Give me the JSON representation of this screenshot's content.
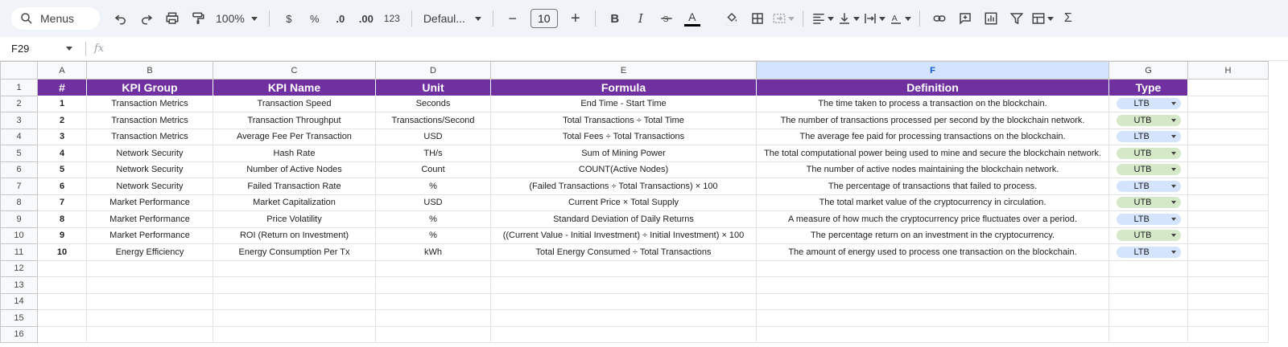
{
  "toolbar": {
    "search_label": "Menus",
    "zoom": "100%",
    "currency_symbol": "$",
    "percent_symbol": "%",
    "decrease_decimal": ".0",
    "increase_decimal": ".00",
    "number_format": "123",
    "font": "Defaul...",
    "font_size": "10",
    "minus": "−",
    "plus": "+",
    "bold": "B",
    "italic": "I",
    "text_color": "A",
    "function_sigma": "Σ"
  },
  "formula_bar": {
    "cell_ref": "F29",
    "fx_label": "fx",
    "content": ""
  },
  "columns": [
    "A",
    "B",
    "C",
    "D",
    "E",
    "F",
    "G",
    "H"
  ],
  "selected_column": "F",
  "row_numbers": [
    "1",
    "2",
    "3",
    "4",
    "5",
    "6",
    "7",
    "8",
    "9",
    "10",
    "11",
    "12",
    "13",
    "14",
    "15",
    "16"
  ],
  "header_row": [
    "#",
    "KPI Group",
    "KPI Name",
    "Unit",
    "Formula",
    "Definition",
    "Type"
  ],
  "rows": [
    {
      "num": "1",
      "group": "Transaction Metrics",
      "name": "Transaction Speed",
      "unit": "Seconds",
      "formula": "End Time - Start Time",
      "definition": "The time taken to process a transaction on the blockchain.",
      "type": "LTB"
    },
    {
      "num": "2",
      "group": "Transaction Metrics",
      "name": "Transaction Throughput",
      "unit": "Transactions/Second",
      "formula": "Total Transactions ÷ Total Time",
      "definition": "The number of transactions processed per second by the blockchain network.",
      "type": "UTB"
    },
    {
      "num": "3",
      "group": "Transaction Metrics",
      "name": "Average Fee Per Transaction",
      "unit": "USD",
      "formula": "Total Fees ÷ Total Transactions",
      "definition": "The average fee paid for processing transactions on the blockchain.",
      "type": "LTB"
    },
    {
      "num": "4",
      "group": "Network Security",
      "name": "Hash Rate",
      "unit": "TH/s",
      "formula": "Sum of Mining Power",
      "definition": "The total computational power being used to mine and secure the blockchain network.",
      "type": "UTB"
    },
    {
      "num": "5",
      "group": "Network Security",
      "name": "Number of Active Nodes",
      "unit": "Count",
      "formula": "COUNT(Active Nodes)",
      "definition": "The number of active nodes maintaining the blockchain network.",
      "type": "UTB"
    },
    {
      "num": "6",
      "group": "Network Security",
      "name": "Failed Transaction Rate",
      "unit": "%",
      "formula": "(Failed Transactions ÷ Total Transactions) × 100",
      "definition": "The percentage of transactions that failed to process.",
      "type": "LTB"
    },
    {
      "num": "7",
      "group": "Market Performance",
      "name": "Market Capitalization",
      "unit": "USD",
      "formula": "Current Price × Total Supply",
      "definition": "The total market value of the cryptocurrency in circulation.",
      "type": "UTB"
    },
    {
      "num": "8",
      "group": "Market Performance",
      "name": "Price Volatility",
      "unit": "%",
      "formula": "Standard Deviation of Daily Returns",
      "definition": "A measure of how much the cryptocurrency price fluctuates over a period.",
      "type": "LTB"
    },
    {
      "num": "9",
      "group": "Market Performance",
      "name": "ROI (Return on Investment)",
      "unit": "%",
      "formula": "((Current Value - Initial Investment) ÷ Initial Investment) × 100",
      "definition": "The percentage return on an investment in the cryptocurrency.",
      "type": "UTB"
    },
    {
      "num": "10",
      "group": "Energy Efficiency",
      "name": "Energy Consumption Per Tx",
      "unit": "kWh",
      "formula": "Total Energy Consumed ÷ Total Transactions",
      "definition": "The amount of energy used to process one transaction on the blockchain.",
      "type": "LTB"
    }
  ],
  "colors": {
    "header_bg": "#7030a0",
    "ltb_chip": "#d4e4fc",
    "utb_chip": "#d5e8c8",
    "toolbar_bg": "#f0f4f9"
  }
}
